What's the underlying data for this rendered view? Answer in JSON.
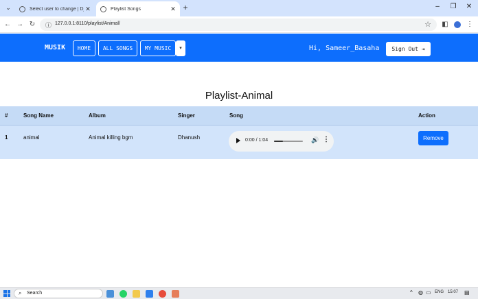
{
  "browser": {
    "tabs": [
      {
        "title": "Select user to change | Django",
        "active": false
      },
      {
        "title": "Playlist Songs",
        "active": true
      }
    ],
    "url": "127.0.0.1:8110/playlist/Animal/"
  },
  "nav": {
    "brand": "MUSIK",
    "links": [
      "HOME",
      "ALL SONGS",
      "MY MUSIC"
    ],
    "greeting": "Hi, Sameer_Basaha",
    "signout": "Sign Out"
  },
  "page": {
    "title": "Playlist-Animal"
  },
  "table": {
    "columns": [
      "#",
      "Song Name",
      "Album",
      "Singer",
      "Song",
      "Action"
    ],
    "rows": [
      {
        "num": "1",
        "song_name": "animal",
        "album": "Animal killing bgm",
        "singer": "Dhanush",
        "audio": {
          "time": "0:00 / 1:04",
          "progress": 0.3
        },
        "action": "Remove"
      }
    ]
  },
  "taskbar": {
    "search": "Search",
    "lang": "ENG",
    "time": "15:07"
  },
  "colors": {
    "navbar": "#0d6efd",
    "header_row": "#c5dbf6",
    "data_row": "#d2e4fb",
    "button": "#0d6efd"
  }
}
